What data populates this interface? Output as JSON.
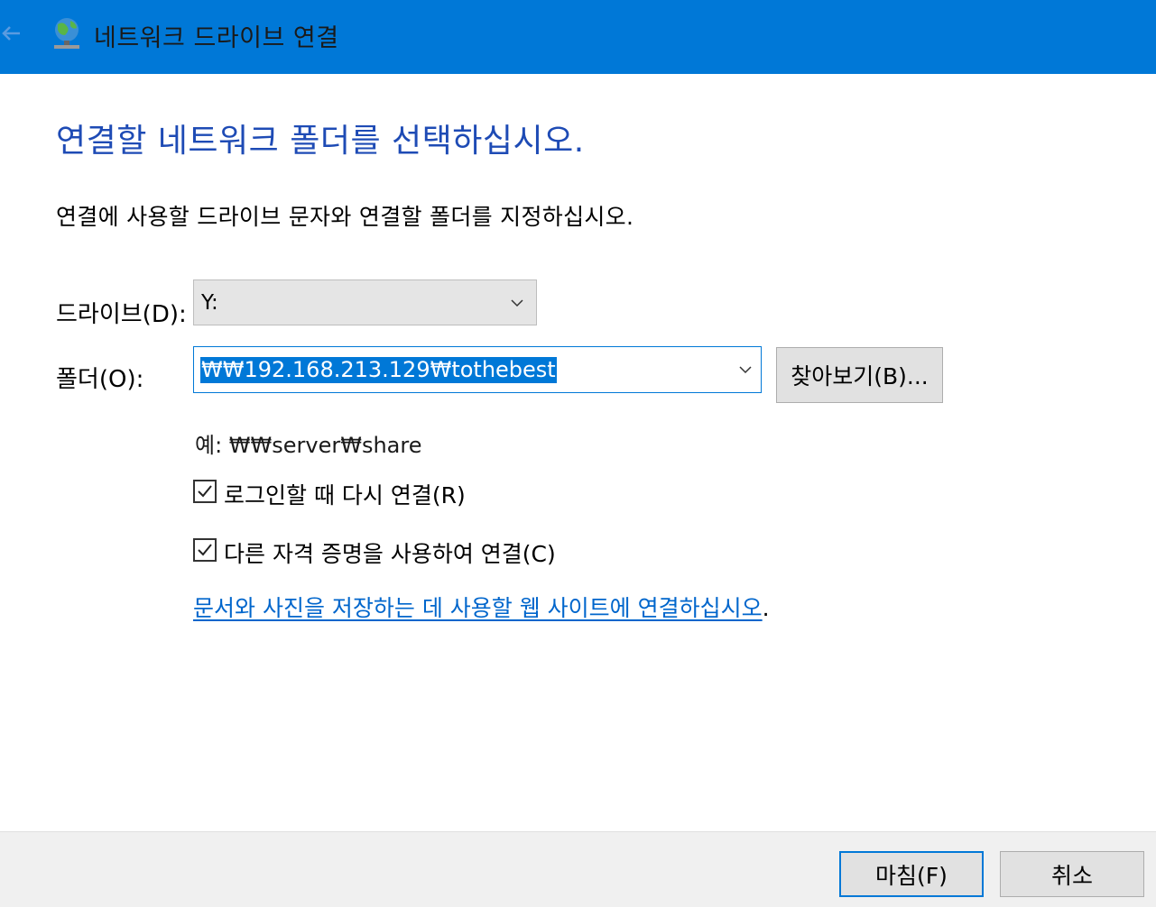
{
  "window": {
    "title": "네트워크 드라이브 연결",
    "icons": {
      "back": "back-arrow-icon",
      "app": "network-drive-icon"
    },
    "accent_color": "#0078d7"
  },
  "main": {
    "heading": "연결할 네트워크 폴더를 선택하십시오.",
    "instruction": "연결에 사용할 드라이브 문자와 연결할 폴더를 지정하십시오.",
    "drive_label": "드라이브(D):",
    "drive_value": "Y:",
    "folder_label": "폴더(O):",
    "folder_value": "₩₩192.168.213.129₩tothebest",
    "browse_button": "찾아보기(B)...",
    "example": "예: ₩₩server₩share",
    "reconnect_checkbox": {
      "label": "로그인할 때 다시 연결(R)",
      "checked": true
    },
    "credentials_checkbox": {
      "label": "다른 자격 증명을 사용하여 연결(C)",
      "checked": true
    },
    "link_text": "문서와 사진을 저장하는 데 사용할 웹 사이트에 연결하십시오",
    "link_suffix": "."
  },
  "footer": {
    "finish_button": "마침(F)",
    "cancel_button": "취소"
  }
}
